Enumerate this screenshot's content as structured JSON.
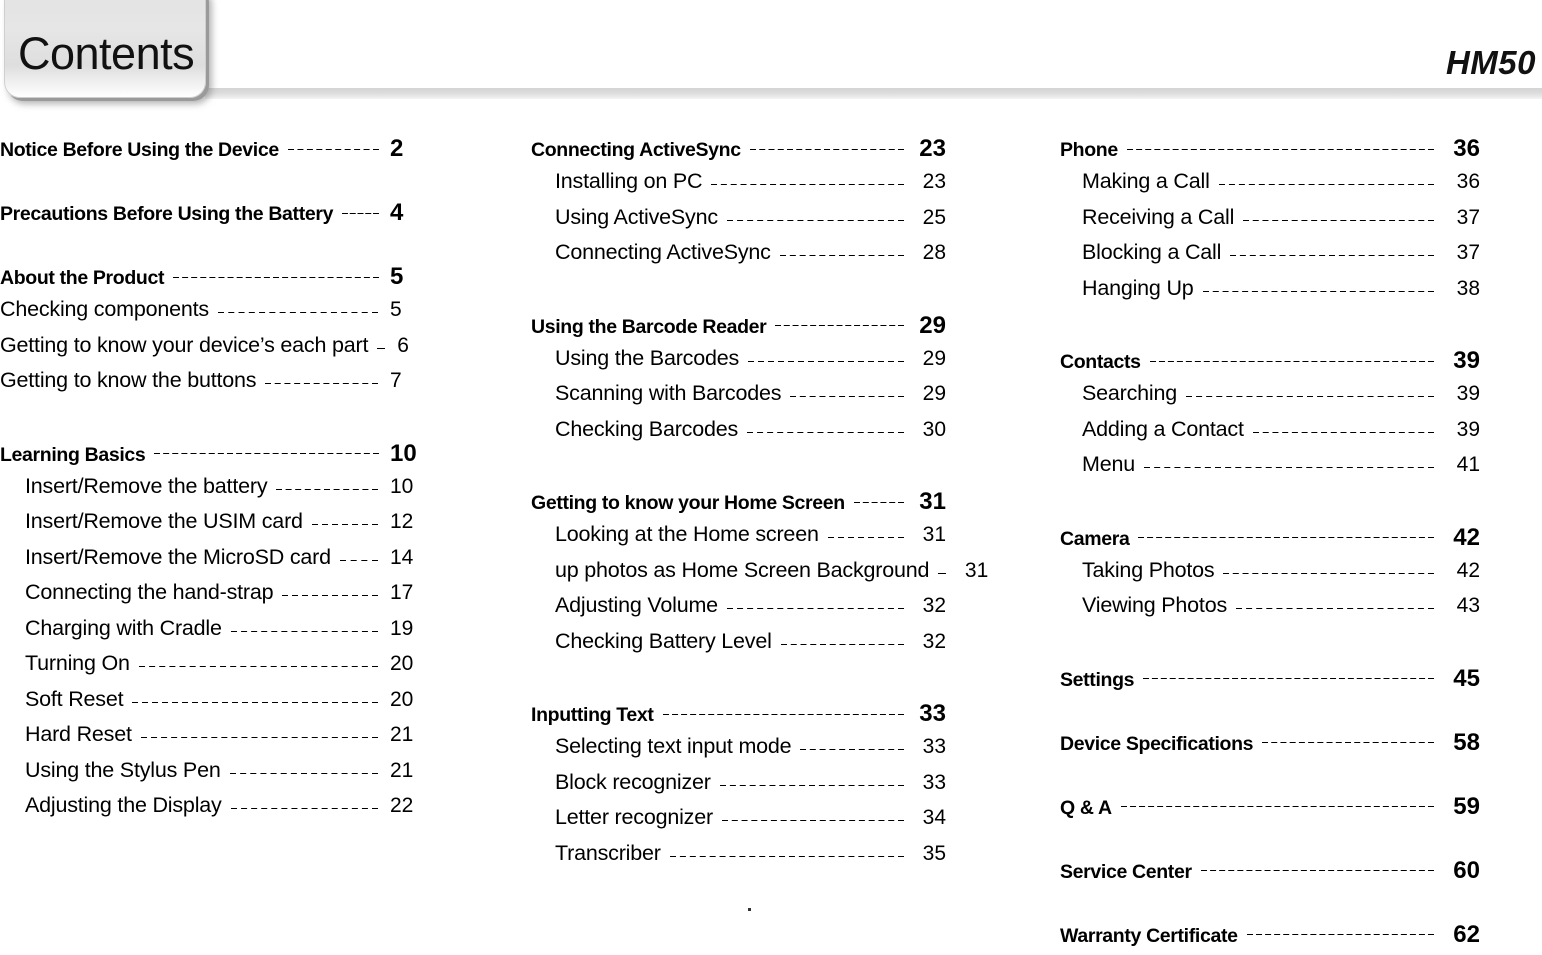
{
  "header": {
    "tab_label": "Contents",
    "model": "HM50"
  },
  "columns": [
    {
      "id": "column-1",
      "groups": [
        {
          "head": {
            "label": "Notice Before Using the Device",
            "page": "2"
          },
          "subs": []
        },
        {
          "head": {
            "label": "Precautions Before Using the Battery",
            "page": "4"
          },
          "subs": []
        },
        {
          "head": {
            "label": "About the Product",
            "page": "5"
          },
          "indent": false,
          "subs": [
            {
              "label": "Checking components",
              "page": "5"
            },
            {
              "label": "Getting to know your device’s each part",
              "page": "6"
            },
            {
              "label": "Getting to know the buttons",
              "page": "7"
            }
          ]
        },
        {
          "head": {
            "label": "Learning Basics",
            "page": "10"
          },
          "indent": true,
          "subs": [
            {
              "label": "Insert/Remove the battery",
              "page": "10"
            },
            {
              "label": "Insert/Remove the USIM card",
              "page": "12"
            },
            {
              "label": "Insert/Remove the MicroSD card",
              "page": "14"
            },
            {
              "label": "Connecting the hand-strap",
              "page": "17"
            },
            {
              "label": "Charging with Cradle",
              "page": "19"
            },
            {
              "label": "Turning On",
              "page": "20"
            },
            {
              "label": "Soft Reset",
              "page": "20"
            },
            {
              "label": "Hard Reset",
              "page": "21"
            },
            {
              "label": "Using the Stylus Pen",
              "page": "21"
            },
            {
              "label": "Adjusting the Display",
              "page": "22"
            }
          ]
        }
      ]
    },
    {
      "id": "column-2",
      "groups": [
        {
          "head": {
            "label": "Connecting ActiveSync",
            "page": "23"
          },
          "subs": [
            {
              "label": "Installing on PC",
              "page": "23"
            },
            {
              "label": "Using ActiveSync",
              "page": "25"
            },
            {
              "label": "Connecting ActiveSync",
              "page": "28"
            }
          ]
        },
        {
          "head": {
            "label": "Using the Barcode Reader",
            "page": "29"
          },
          "subs": [
            {
              "label": "Using the Barcodes",
              "page": "29"
            },
            {
              "label": "Scanning with Barcodes",
              "page": "29"
            },
            {
              "label": "Checking Barcodes",
              "page": "30"
            }
          ]
        },
        {
          "head": {
            "label": "Getting to know your Home Screen",
            "page": "31"
          },
          "subs": [
            {
              "label": "Looking at the Home screen",
              "page": "31"
            },
            {
              "label": "up photos as Home Screen Background",
              "page": "31"
            },
            {
              "label": "Adjusting Volume",
              "page": "32"
            },
            {
              "label": "Checking Battery Level",
              "page": "32"
            }
          ]
        },
        {
          "head": {
            "label": "Inputting Text",
            "page": "33"
          },
          "subs": [
            {
              "label": "Selecting text input mode",
              "page": "33"
            },
            {
              "label": "Block recognizer",
              "page": "33"
            },
            {
              "label": "Letter recognizer",
              "page": "34"
            },
            {
              "label": "Transcriber",
              "page": "35"
            }
          ]
        }
      ]
    },
    {
      "id": "column-3",
      "groups": [
        {
          "head": {
            "label": "Phone",
            "page": "36"
          },
          "subs": [
            {
              "label": "Making a Call",
              "page": "36"
            },
            {
              "label": "Receiving a Call",
              "page": "37"
            },
            {
              "label": "Blocking a Call",
              "page": "37"
            },
            {
              "label": "Hanging Up",
              "page": "38"
            }
          ]
        },
        {
          "head": {
            "label": "Contacts",
            "page": "39"
          },
          "subs": [
            {
              "label": "Searching",
              "page": "39"
            },
            {
              "label": "Adding a Contact",
              "page": "39"
            },
            {
              "label": "Menu",
              "page": "41"
            }
          ]
        },
        {
          "head": {
            "label": "Camera",
            "page": "42"
          },
          "subs": [
            {
              "label": "Taking Photos",
              "page": "42"
            },
            {
              "label": "Viewing Photos",
              "page": "43"
            }
          ]
        },
        {
          "head": {
            "label": "Settings",
            "page": "45"
          },
          "subs": []
        },
        {
          "head": {
            "label": "Device Specifications",
            "page": "58"
          },
          "subs": []
        },
        {
          "head": {
            "label": "Q & A",
            "page": "59"
          },
          "subs": []
        },
        {
          "head": {
            "label": "Service Center",
            "page": "60"
          },
          "subs": []
        },
        {
          "head": {
            "label": "Warranty Certificate",
            "page": "62"
          },
          "subs": []
        }
      ]
    }
  ]
}
